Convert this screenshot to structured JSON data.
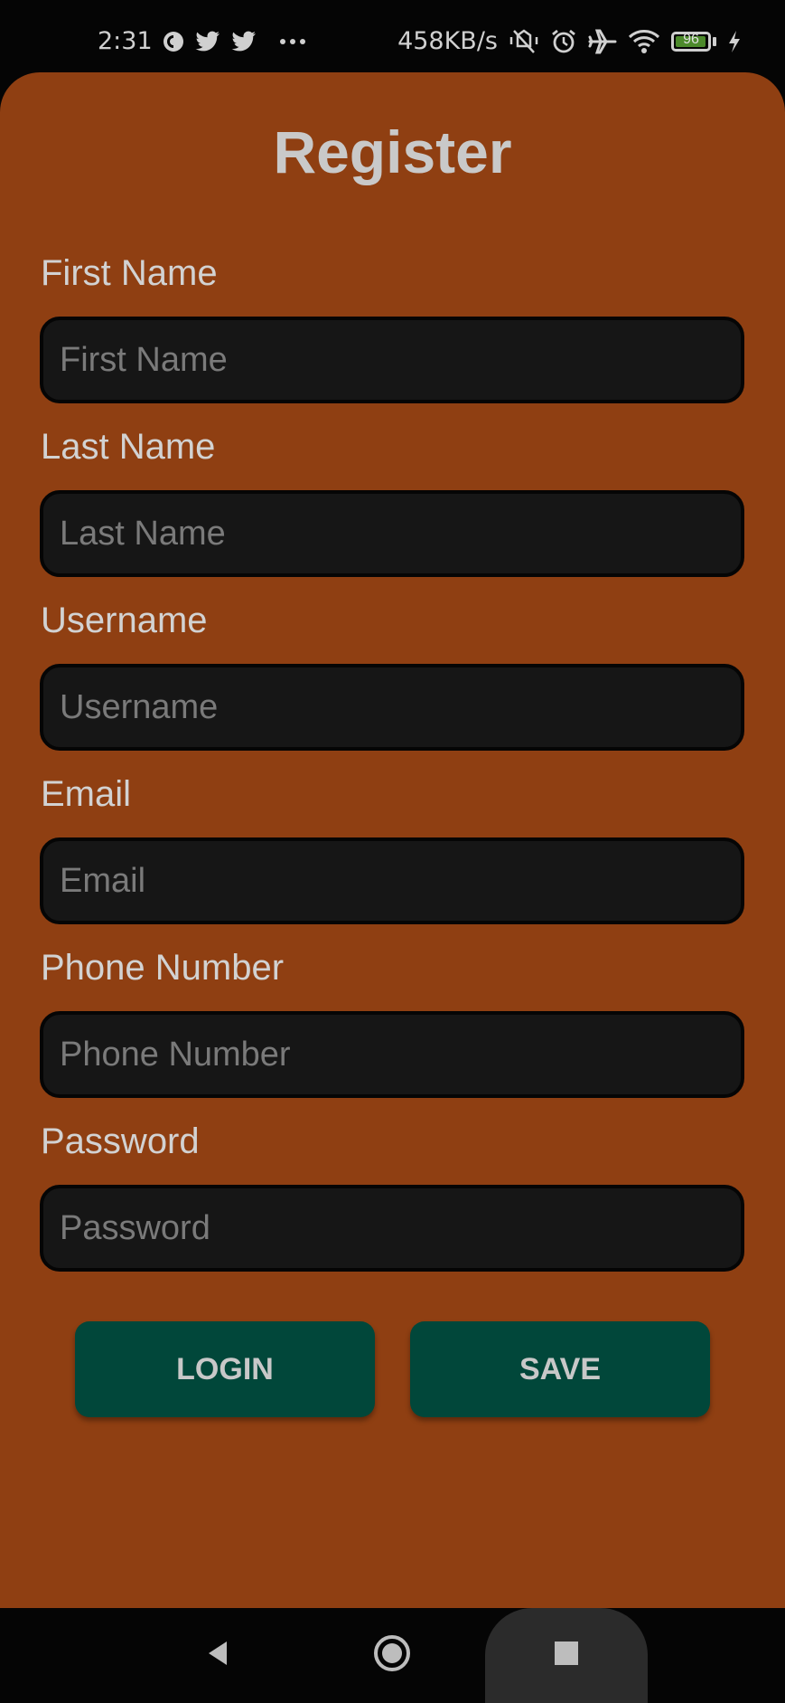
{
  "status_bar": {
    "time": "2:31",
    "notification_icons": [
      "pocket-casts-icon",
      "twitter-icon",
      "twitter-icon",
      "more-dots-icon"
    ],
    "network_speed": "458KB/s",
    "system_icons": [
      "vibrate-off-icon",
      "alarm-icon",
      "airplane-icon",
      "wifi-icon",
      "battery-icon",
      "charging-icon"
    ],
    "battery_level": "96",
    "battery_fraction": 0.96
  },
  "form": {
    "title": "Register",
    "fields": [
      {
        "label": "First Name",
        "placeholder": "First Name"
      },
      {
        "label": "Last Name",
        "placeholder": "Last Name"
      },
      {
        "label": "Username",
        "placeholder": "Username"
      },
      {
        "label": "Email",
        "placeholder": "Email"
      },
      {
        "label": "Phone Number",
        "placeholder": "Phone Number"
      },
      {
        "label": "Password",
        "placeholder": "Password"
      }
    ],
    "login_label": "LOGIN",
    "save_label": "SAVE"
  },
  "colors": {
    "card_background": "#8f3f12",
    "input_background": "#161616",
    "button_background": "#01473a",
    "screen_background": "#050505"
  },
  "nav_bar": {
    "buttons": [
      "back-icon",
      "home-icon",
      "recents-icon"
    ]
  }
}
